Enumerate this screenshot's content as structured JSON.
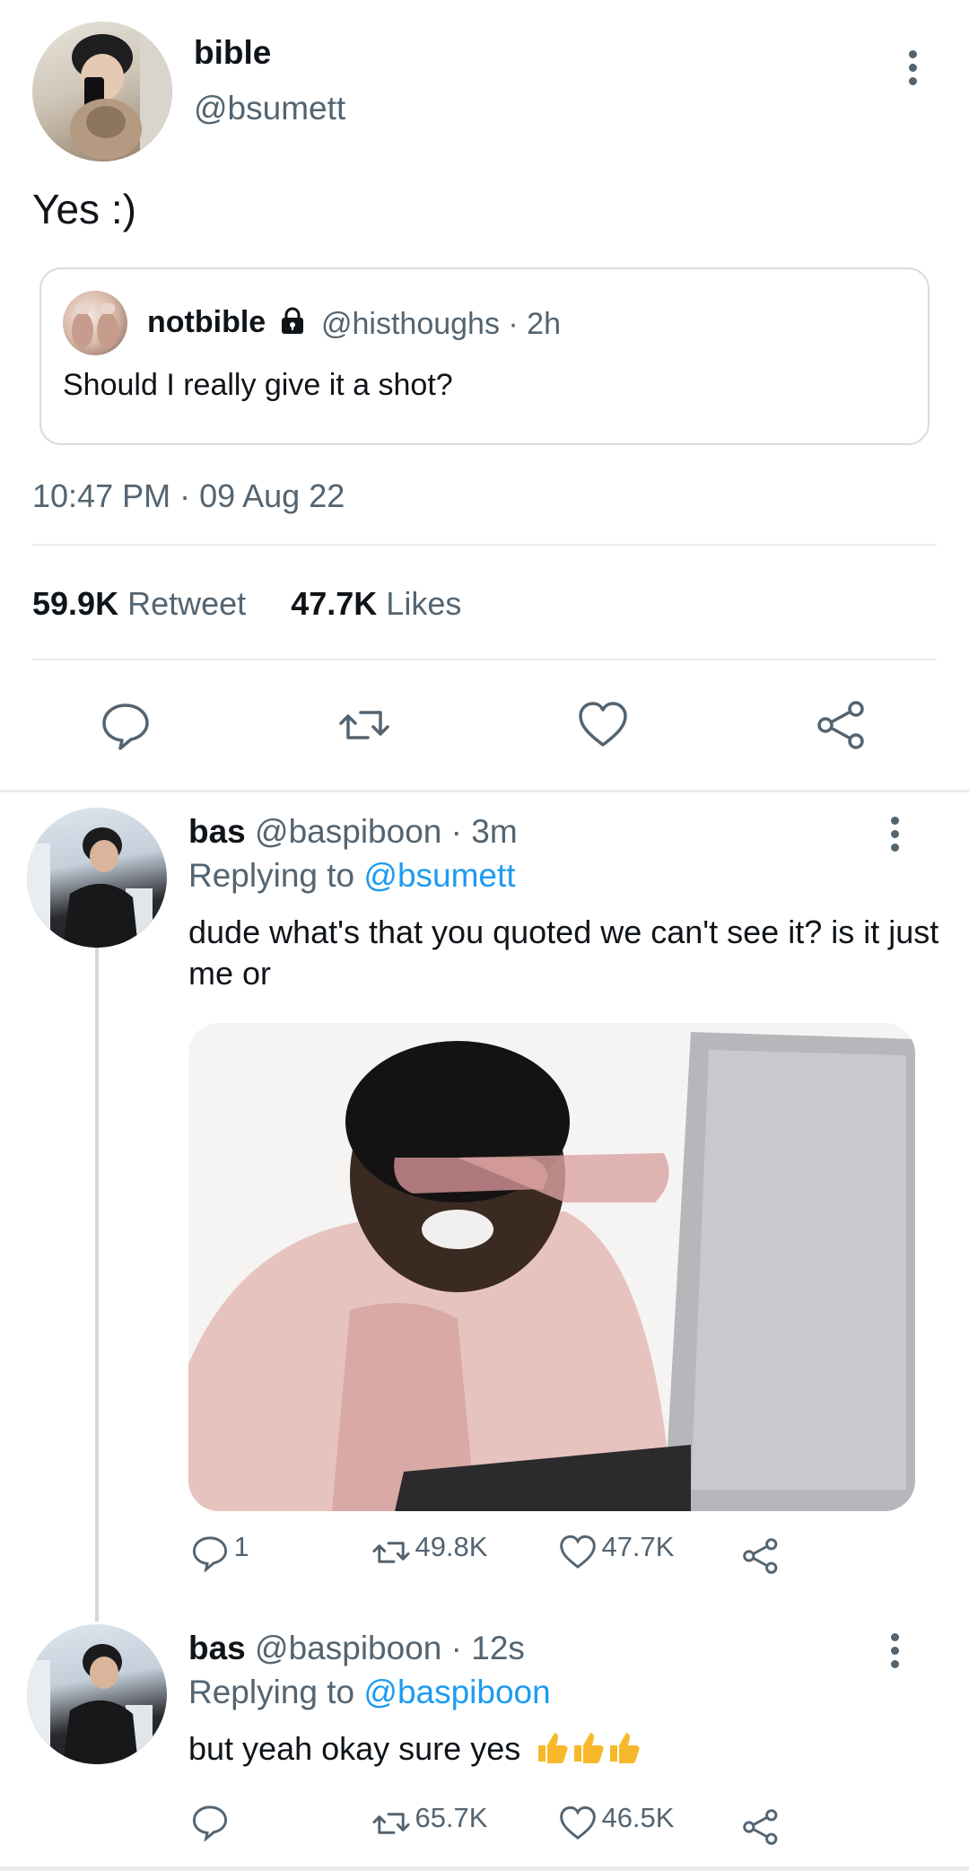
{
  "main_tweet": {
    "display_name": "bible",
    "handle": "@bsumett",
    "text": "Yes :)",
    "quote": {
      "display_name": "notbible",
      "handle_time": "@histhoughs · 2h",
      "text": "Should I really give it a shot?"
    },
    "timestamp": "10:47 PM · 09 Aug 22",
    "retweet_count": "59.9K",
    "retweet_label": "Retweet",
    "likes_count": "47.7K",
    "likes_label": "Likes",
    "actions": [
      "reply-icon",
      "retweet-icon",
      "like-icon",
      "share-icon"
    ]
  },
  "replies": [
    {
      "display_name": "bas",
      "handle_time": "@baspiboon · 3m",
      "replying_prefix": "Replying to",
      "replying_to": "@bsumett",
      "text": "dude what's that you quoted we can't see it? is it just me or",
      "reply_count": "1",
      "retweet_count": "49.8K",
      "like_count": "47.7K"
    },
    {
      "display_name": "bas",
      "handle_time": "@baspiboon · 12s",
      "replying_prefix": "Replying to",
      "replying_to": "@baspiboon",
      "text": "but yeah okay sure yes",
      "emojis": "👍👍👍",
      "retweet_count": "65.7K",
      "like_count": "46.5K"
    }
  ],
  "colors": {
    "accent": "#1d9bf0",
    "muted": "#536471",
    "divider": "#e7ebed"
  }
}
